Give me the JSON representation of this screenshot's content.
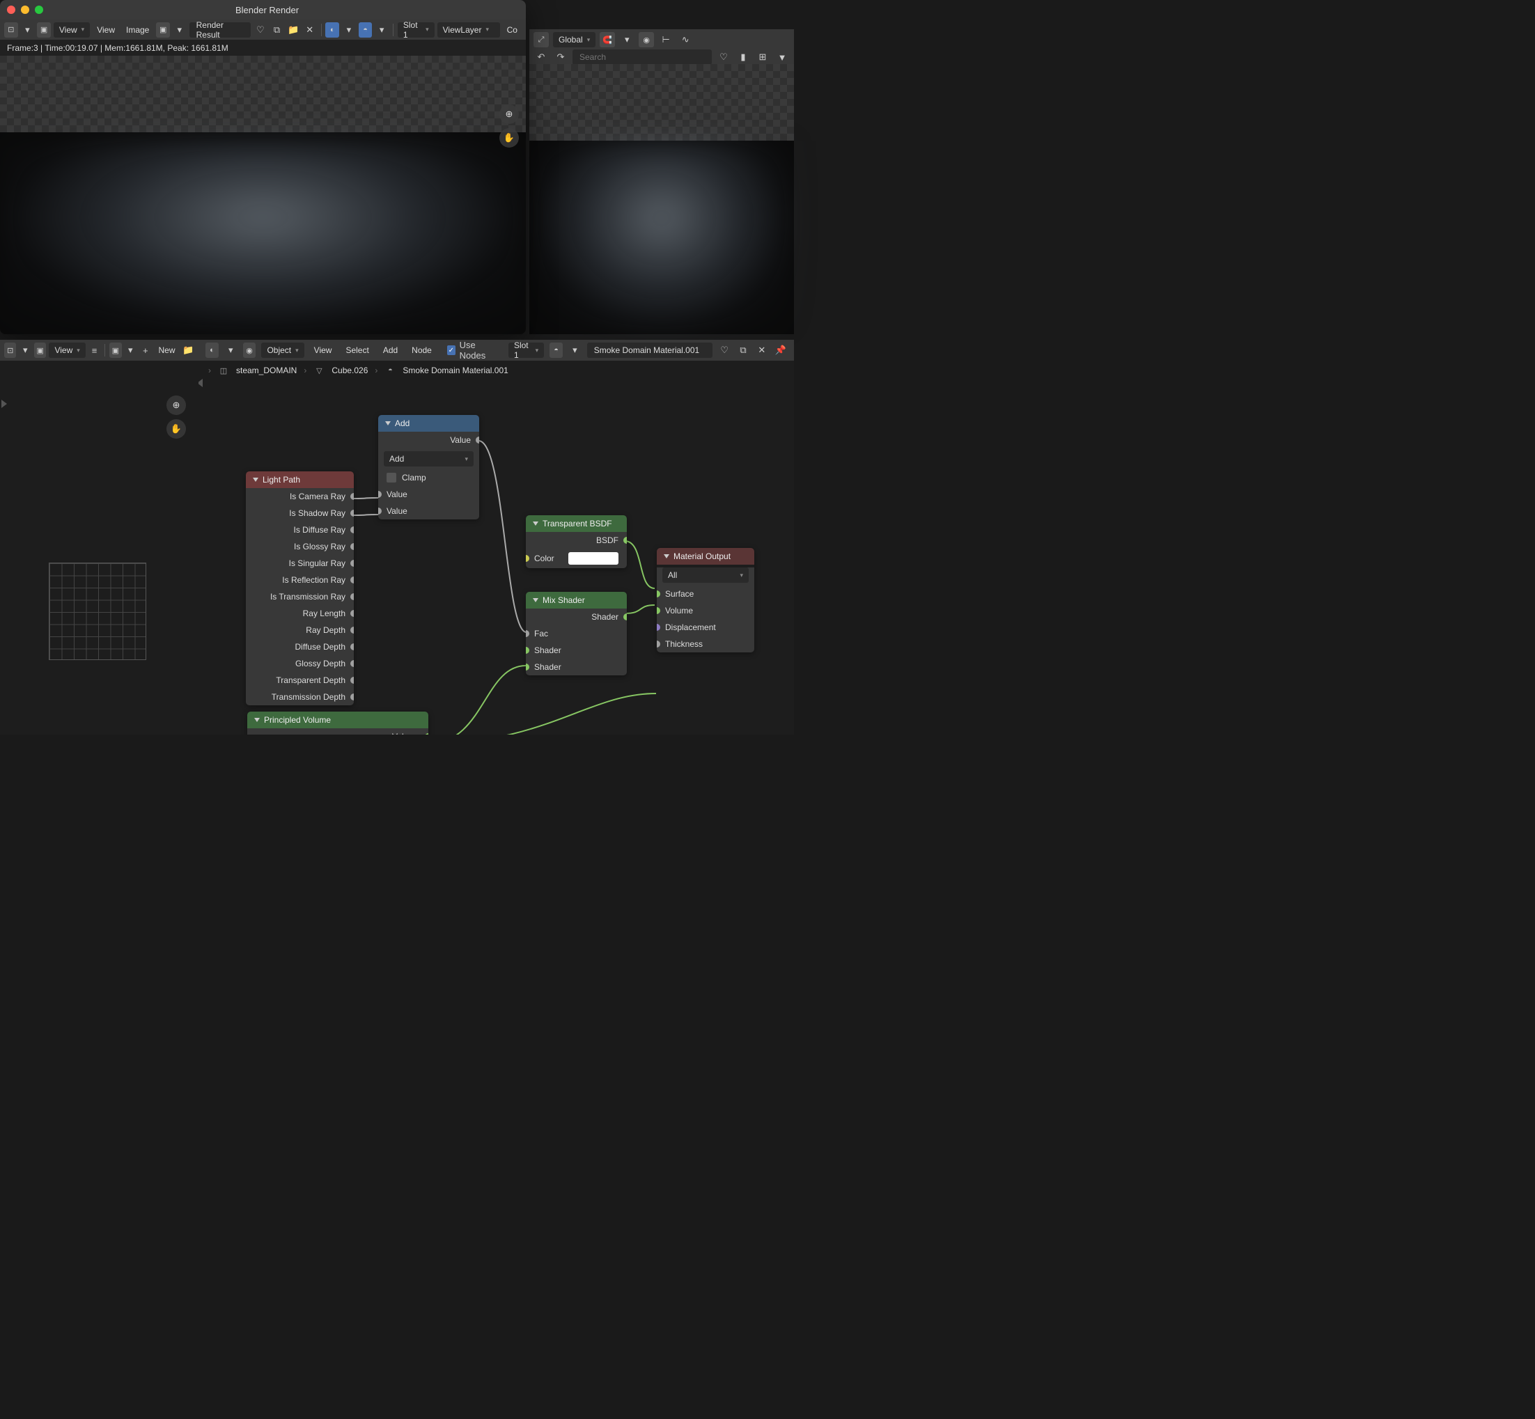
{
  "render_window": {
    "title": "Blender Render",
    "toolbar": {
      "view": "View",
      "view2": "View",
      "image": "Image",
      "render_result": "Render Result",
      "slot": "Slot 1",
      "view_layer": "ViewLayer",
      "compositor": "Co"
    },
    "info": "Frame:3 | Time:00:19.07 | Mem:1661.81M, Peak: 1661.81M"
  },
  "bg_toolbar": {
    "global": "Global",
    "search_placeholder": "Search"
  },
  "left_panel": {
    "view": "View",
    "new": "New"
  },
  "node_editor": {
    "toolbar": {
      "object": "Object",
      "view": "View",
      "select": "Select",
      "add": "Add",
      "node": "Node",
      "use_nodes": "Use Nodes",
      "slot": "Slot 1",
      "material": "Smoke Domain Material.001"
    },
    "breadcrumb": {
      "item1": "steam_DOMAIN",
      "item2": "Cube.026",
      "item3": "Smoke Domain Material.001"
    }
  },
  "nodes": {
    "light_path": {
      "title": "Light Path",
      "outputs": [
        "Is Camera Ray",
        "Is Shadow Ray",
        "Is Diffuse Ray",
        "Is Glossy Ray",
        "Is Singular Ray",
        "Is Reflection Ray",
        "Is Transmission Ray",
        "Ray Length",
        "Ray Depth",
        "Diffuse Depth",
        "Glossy Depth",
        "Transparent Depth",
        "Transmission Depth"
      ]
    },
    "add": {
      "title": "Add",
      "out_value": "Value",
      "operation": "Add",
      "clamp": "Clamp",
      "in1": "Value",
      "in2": "Value"
    },
    "transparent": {
      "title": "Transparent BSDF",
      "out": "BSDF",
      "color": "Color"
    },
    "mix": {
      "title": "Mix Shader",
      "out": "Shader",
      "fac": "Fac",
      "s1": "Shader",
      "s2": "Shader"
    },
    "output": {
      "title": "Material Output",
      "target": "All",
      "surface": "Surface",
      "volume": "Volume",
      "displacement": "Displacement",
      "thickness": "Thickness"
    },
    "pvol": {
      "title": "Principled Volume",
      "out": "Volume"
    }
  }
}
